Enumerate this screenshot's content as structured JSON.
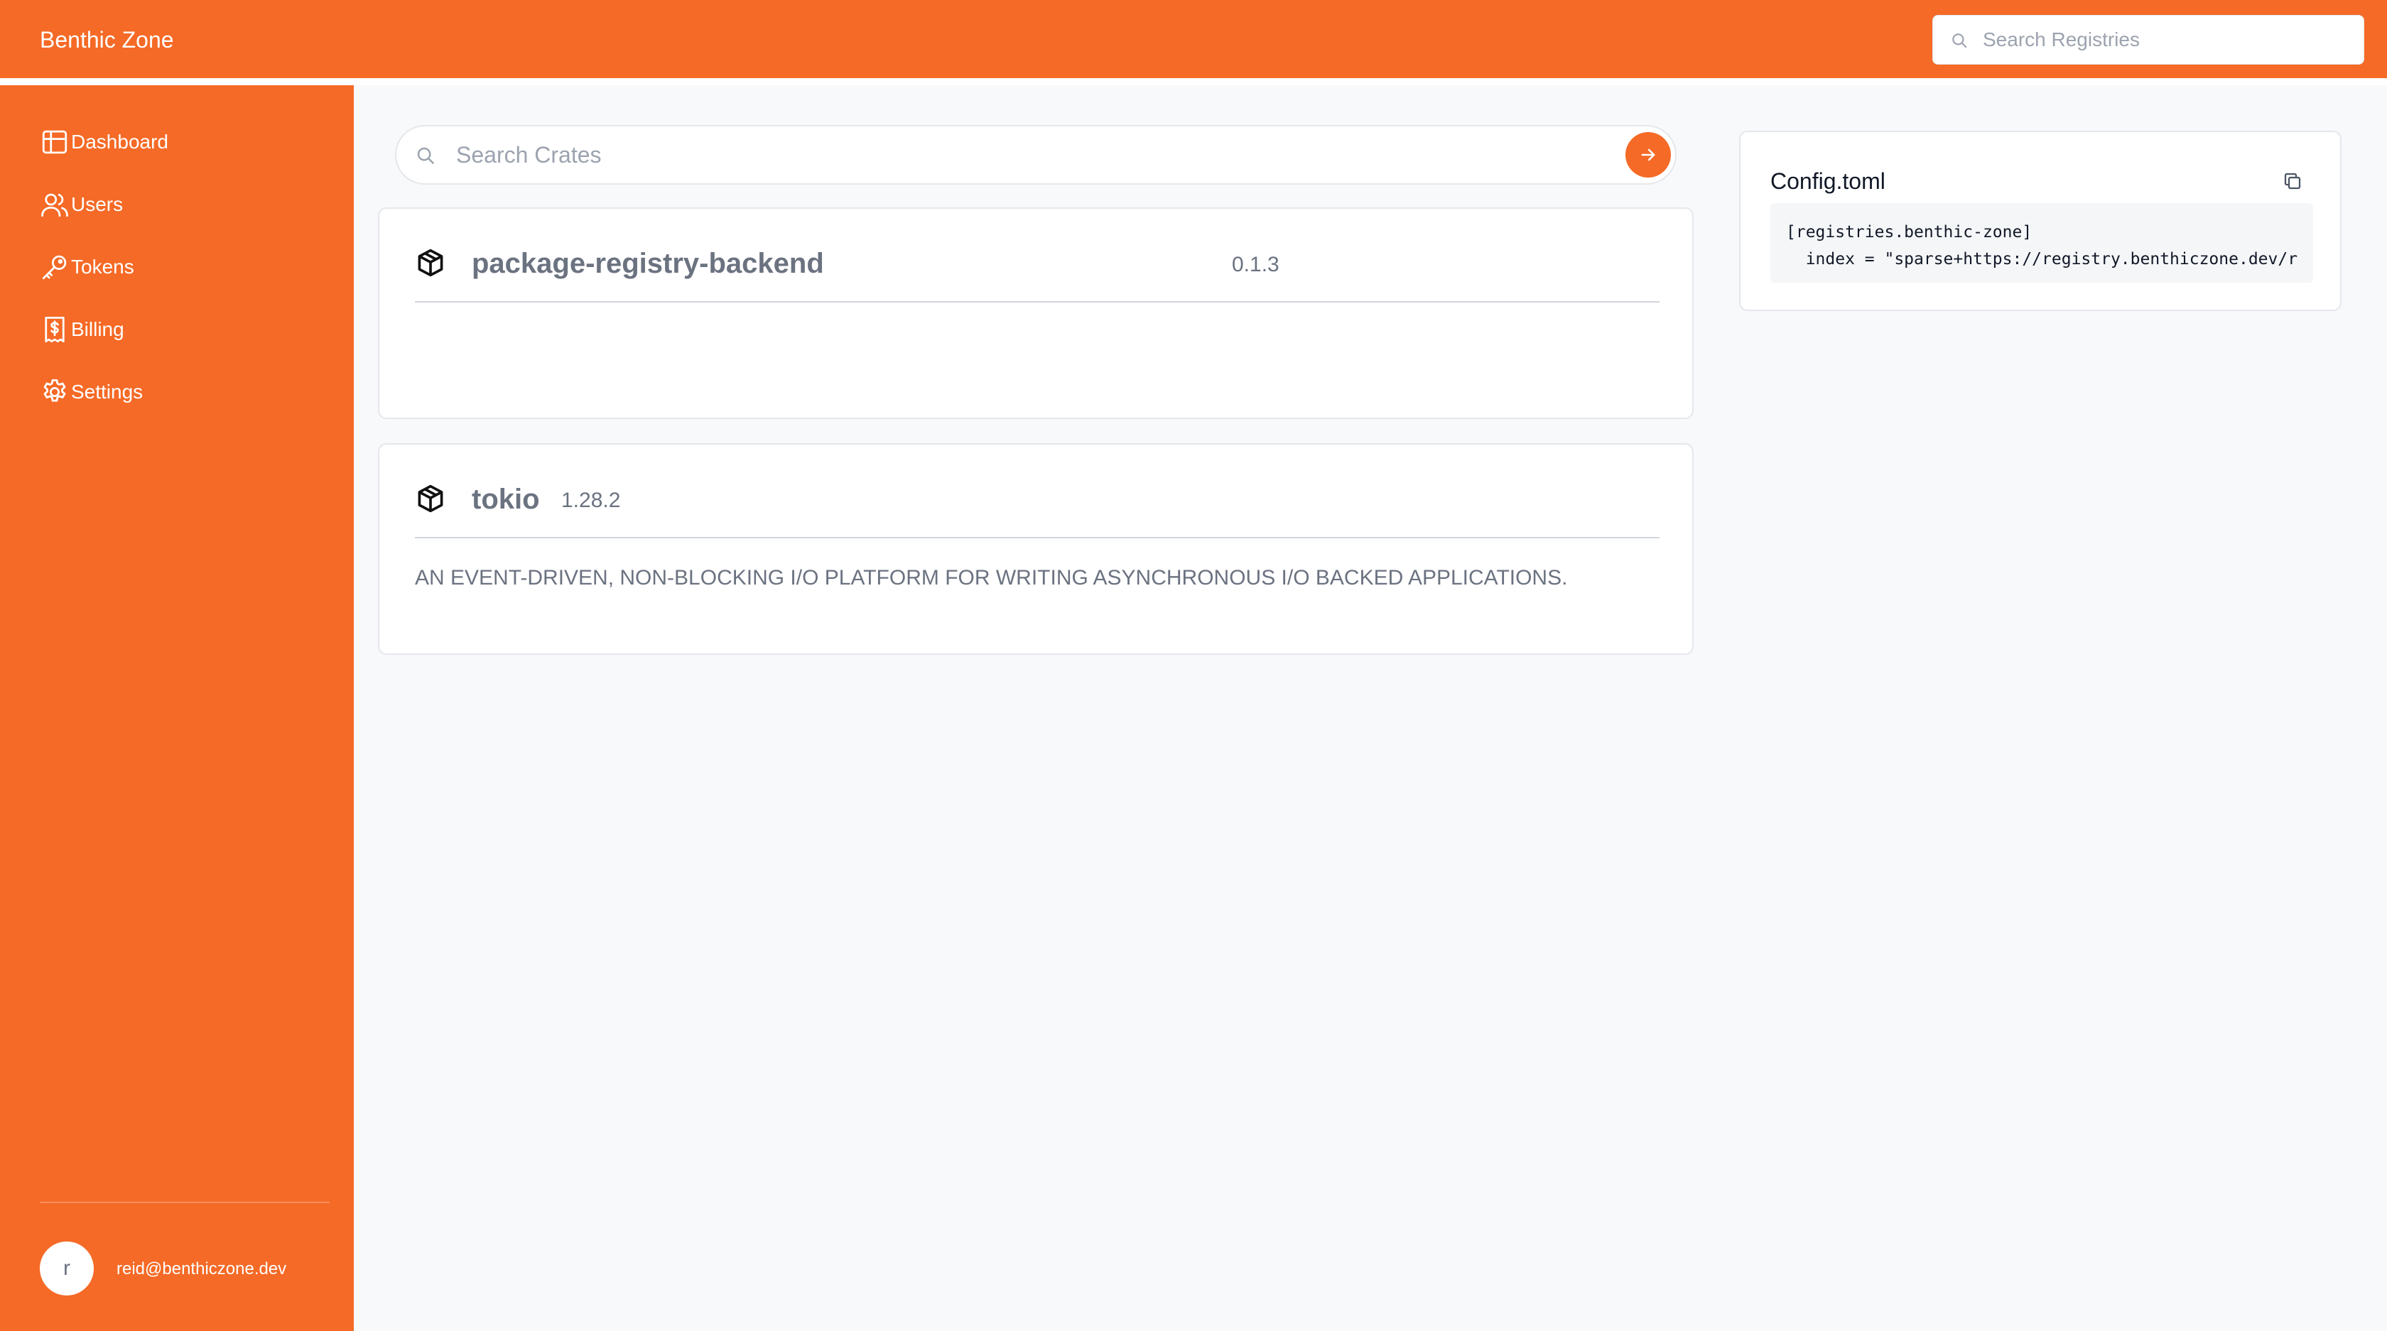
{
  "header": {
    "brand": "Benthic Zone",
    "search_placeholder": "Search Registries"
  },
  "sidebar": {
    "items": [
      {
        "label": "Dashboard",
        "icon": "table-icon"
      },
      {
        "label": "Users",
        "icon": "users-icon"
      },
      {
        "label": "Tokens",
        "icon": "key-icon"
      },
      {
        "label": "Billing",
        "icon": "receipt-icon"
      },
      {
        "label": "Settings",
        "icon": "gear-icon"
      }
    ],
    "user": {
      "avatar_initial": "r",
      "email": "reid@benthiczone.dev"
    }
  },
  "main": {
    "search_placeholder": "Search Crates",
    "crates": [
      {
        "name": "package-registry-backend",
        "version": "0.1.3",
        "description": ""
      },
      {
        "name": "tokio",
        "version": "1.28.2",
        "description": "AN EVENT-DRIVEN, NON-BLOCKING I/O PLATFORM FOR WRITING ASYNCHRONOUS I/O BACKED APPLICATIONS."
      }
    ]
  },
  "config": {
    "title": "Config.toml",
    "code_line1": "[registries.benthic-zone]",
    "code_line2": "  index = \"sparse+https://registry.benthiczone.dev/r"
  },
  "colors": {
    "accent": "#f56a26",
    "background": "#f8f9fb"
  }
}
